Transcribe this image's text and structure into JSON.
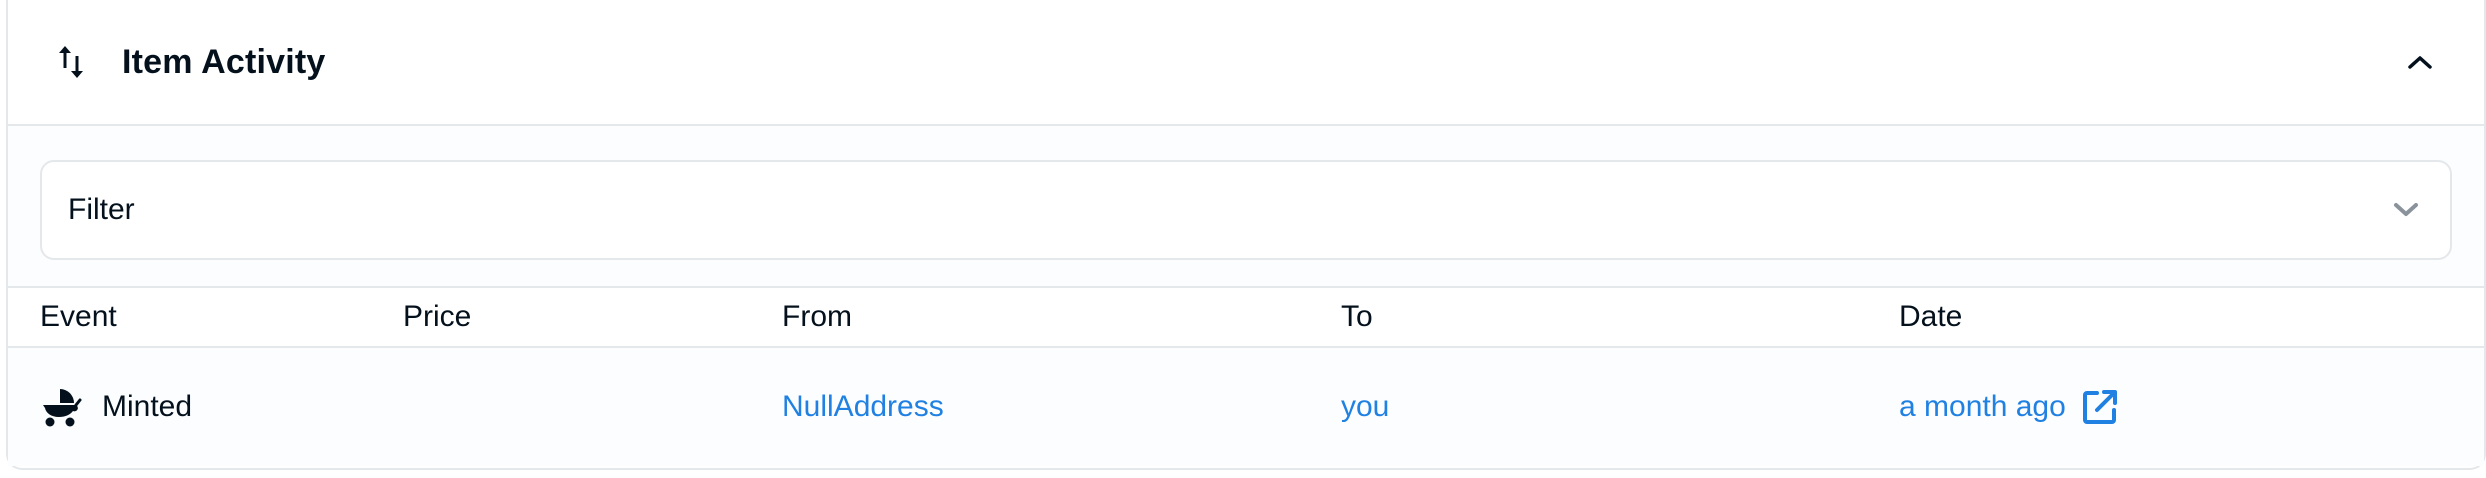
{
  "header": {
    "title": "Item Activity",
    "icon": "swap-vertical-icon",
    "collapse_icon": "chevron-up-icon"
  },
  "filter": {
    "label": "Filter",
    "icon": "chevron-down-icon"
  },
  "table": {
    "columns": [
      "Event",
      "Price",
      "From",
      "To",
      "Date"
    ],
    "rows": [
      {
        "event_icon": "baby-carriage-icon",
        "event": "Minted",
        "price": "",
        "from": "NullAddress",
        "to": "you",
        "date": "a month ago",
        "date_icon": "external-link-icon"
      }
    ]
  },
  "colors": {
    "text": "#04111d",
    "link": "#2081e2",
    "border": "#e5e8eb",
    "muted_bg": "#fbfdff",
    "icon_grey": "#8a939b"
  }
}
